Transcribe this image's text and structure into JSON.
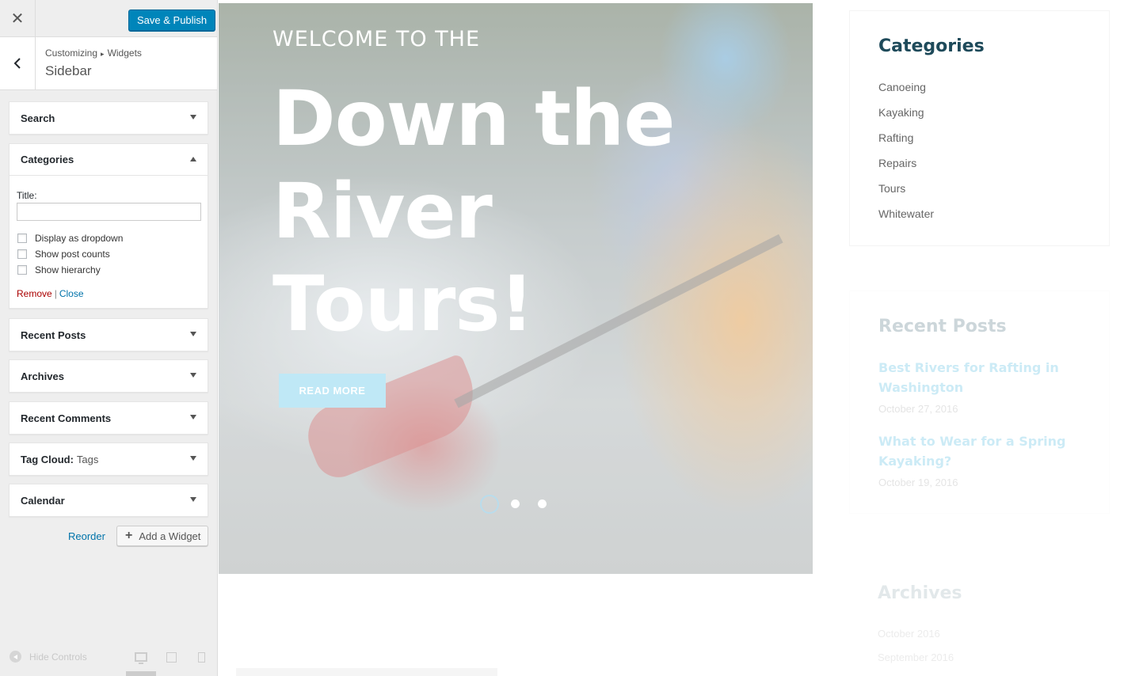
{
  "header": {
    "close_glyph": "✕",
    "save_label": "Save & Publish",
    "save_color": "#0085ba"
  },
  "section": {
    "breadcrumb_root": "Customizing",
    "breadcrumb_sep": "▸",
    "breadcrumb_parent": "Widgets",
    "title": "Sidebar"
  },
  "widgets": [
    {
      "label": "Search",
      "sub": ""
    },
    {
      "label": "Categories",
      "sub": ""
    },
    {
      "label": "Recent Posts",
      "sub": ""
    },
    {
      "label": "Archives",
      "sub": ""
    },
    {
      "label": "Recent Comments",
      "sub": ""
    },
    {
      "label": "Tag Cloud:",
      "sub": "Tags"
    },
    {
      "label": "Calendar",
      "sub": ""
    }
  ],
  "categories_form": {
    "title_label": "Title:",
    "title_value": "",
    "options": [
      {
        "label": "Display as dropdown",
        "checked": false
      },
      {
        "label": "Show post counts",
        "checked": false
      },
      {
        "label": "Show hierarchy",
        "checked": false
      }
    ],
    "remove_label": "Remove",
    "separator": "|",
    "close_label": "Close"
  },
  "actions": {
    "reorder_label": "Reorder",
    "add_widget_label": "Add a Widget",
    "add_glyph": "+"
  },
  "footer": {
    "hide_controls_label": "Hide Controls"
  },
  "hero": {
    "kicker": "WELCOME TO THE",
    "title_line1": "Down the",
    "title_line2": "River",
    "title_line3": "Tours!",
    "button_label": "READ MORE",
    "slide_count": 3,
    "active_slide": 1
  },
  "preview_sidebar": {
    "categories_title": "Categories",
    "categories": [
      "Canoeing",
      "Kayaking",
      "Rafting",
      "Repairs",
      "Tours",
      "Whitewater"
    ],
    "recent_posts_title": "Recent Posts",
    "posts": [
      {
        "title": "Best Rivers for Rafting in Washington",
        "date": "October 27, 2016"
      },
      {
        "title": "What to Wear for a Spring Kayaking?",
        "date": "October 19, 2016"
      }
    ],
    "archives_title": "Archives",
    "archives": [
      "October 2016",
      "September 2016"
    ]
  }
}
